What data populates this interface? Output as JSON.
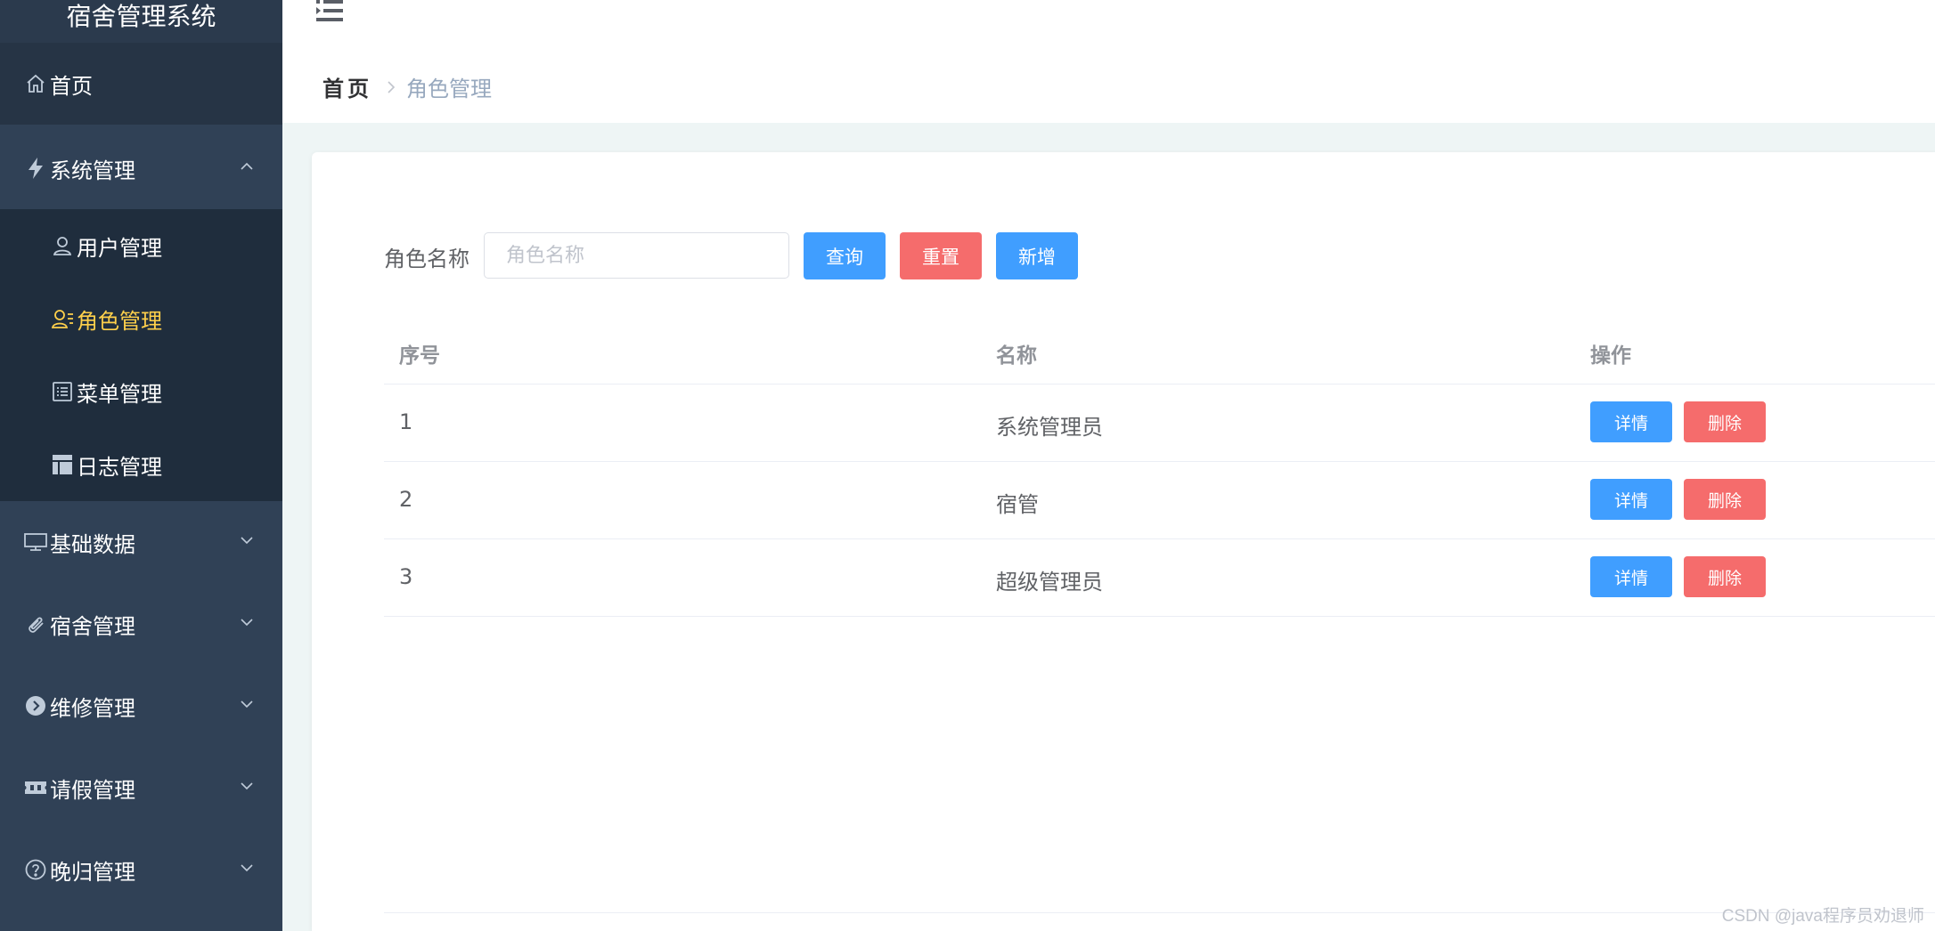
{
  "app": {
    "title": "宿舍管理系统"
  },
  "sidebar": {
    "items": [
      {
        "label": "首页",
        "icon": "home-icon"
      },
      {
        "label": "系统管理",
        "icon": "lightning-icon",
        "expanded": true,
        "children": [
          {
            "label": "用户管理",
            "icon": "user-icon"
          },
          {
            "label": "角色管理",
            "icon": "role-icon",
            "active": true
          },
          {
            "label": "菜单管理",
            "icon": "list-icon"
          },
          {
            "label": "日志管理",
            "icon": "layout-icon"
          }
        ]
      },
      {
        "label": "基础数据",
        "icon": "monitor-icon"
      },
      {
        "label": "宿舍管理",
        "icon": "paperclip-icon"
      },
      {
        "label": "维修管理",
        "icon": "circle-arrow-icon"
      },
      {
        "label": "请假管理",
        "icon": "ticket-icon"
      },
      {
        "label": "晚归管理",
        "icon": "question-icon"
      }
    ]
  },
  "breadcrumb": {
    "home": "首页",
    "current": "角色管理"
  },
  "filter": {
    "label": "角色名称",
    "placeholder": "角色名称",
    "value": "",
    "query_label": "查询",
    "reset_label": "重置",
    "add_label": "新增"
  },
  "table": {
    "columns": [
      "序号",
      "名称",
      "操作"
    ],
    "rows": [
      {
        "index": "1",
        "name": "系统管理员",
        "detail": "详情",
        "delete": "删除"
      },
      {
        "index": "2",
        "name": "宿管",
        "detail": "详情",
        "delete": "删除"
      },
      {
        "index": "3",
        "name": "超级管理员",
        "detail": "详情",
        "delete": "删除"
      }
    ]
  },
  "watermark": "CSDN @java程序员劝退师",
  "colors": {
    "sidebar_bg": "#304156",
    "active": "#ffd04b",
    "primary": "#409eff",
    "danger": "#f56c6c"
  }
}
